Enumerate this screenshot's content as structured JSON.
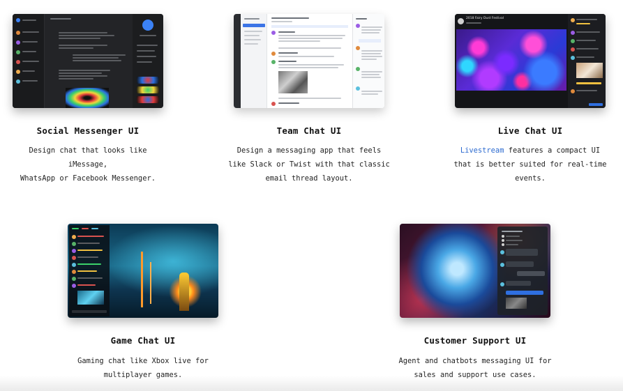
{
  "cards": [
    {
      "title": "Social Messenger UI",
      "desc_lines": [
        "Design chat that looks like iMessage,",
        "WhatsApp or Facebook Messenger."
      ]
    },
    {
      "title": "Team Chat UI",
      "desc_lines": [
        "Design a messaging app that feels",
        "like Slack or Twist with that classic",
        "email thread layout."
      ]
    },
    {
      "title": "Live Chat UI",
      "desc_link": "Livestream",
      "desc_first_rest": " features a compact UI",
      "desc_lines": [
        "that is better suited for real-time",
        "events."
      ],
      "stream_title": "2018 Fairy Dust Festival"
    },
    {
      "title": "Game Chat UI",
      "desc_lines": [
        "Gaming chat like Xbox live for",
        "multiplayer games."
      ]
    },
    {
      "title": "Customer Support UI",
      "desc_lines": [
        "Agent and chatbots messaging UI for",
        "sales and support use cases."
      ]
    }
  ],
  "colors": {
    "link": "#2d6bd0",
    "dark_ui": "#1f2022",
    "accent_blue": "#2f6fe0"
  }
}
